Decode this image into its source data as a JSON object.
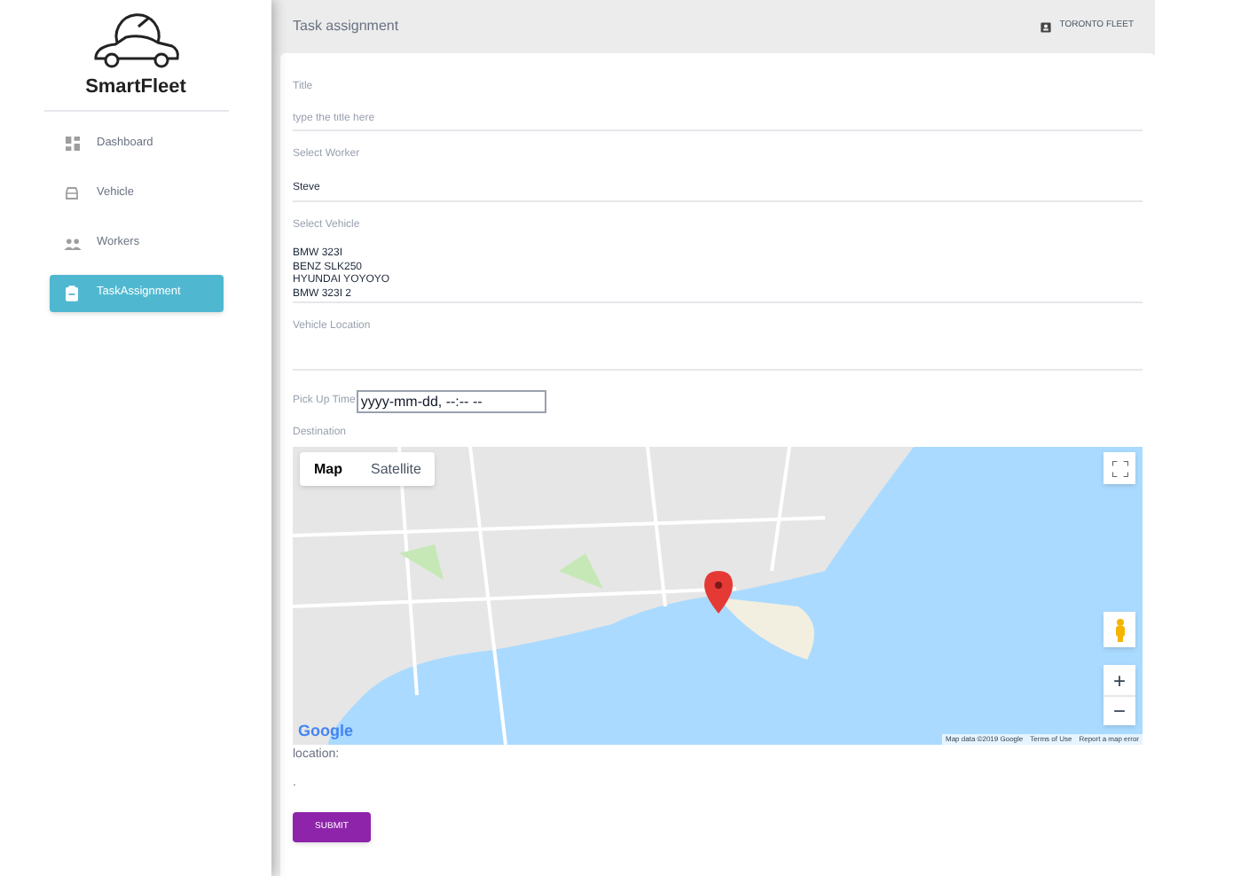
{
  "sidebar": {
    "logo_text": "SmartFleet",
    "items": [
      {
        "label": "Dashboard",
        "selected": false
      },
      {
        "label": "Vehicle",
        "selected": false
      },
      {
        "label": "Workers",
        "selected": false
      },
      {
        "label": "TaskAssignment",
        "selected": true
      }
    ]
  },
  "header": {
    "title": "Task assignment",
    "account": "TORONTO FLEET"
  },
  "form": {
    "title_field": {
      "label": "Title",
      "placeholder": "type the title here"
    },
    "worker_field": {
      "label": "Select Worker",
      "value": "Steve"
    },
    "vehicle_field": {
      "label": "Select Vehicle",
      "options": [
        "BMW 323I",
        "BENZ SLK250",
        "HYUNDAI YOYOYO",
        "BMW 323I 2"
      ]
    },
    "location_field": {
      "label": "Vehicle Location"
    },
    "pickup_field": {
      "label": "Pick Up Time",
      "placeholder": "yyyy-mm-dd, --:-- --"
    },
    "destination": {
      "label": "Destination",
      "map": {
        "tabs": [
          {
            "label": "Map",
            "selected": true
          },
          {
            "label": "Satellite",
            "selected": false
          }
        ],
        "zoom_in": "+",
        "zoom_out": "−",
        "logo": "Google",
        "attribution": [
          "Map data ©2019 Google",
          "Terms of Use",
          "Report a map error"
        ]
      }
    },
    "location_label": "location:",
    "location_value": ".",
    "submit": "SUBMIT"
  }
}
